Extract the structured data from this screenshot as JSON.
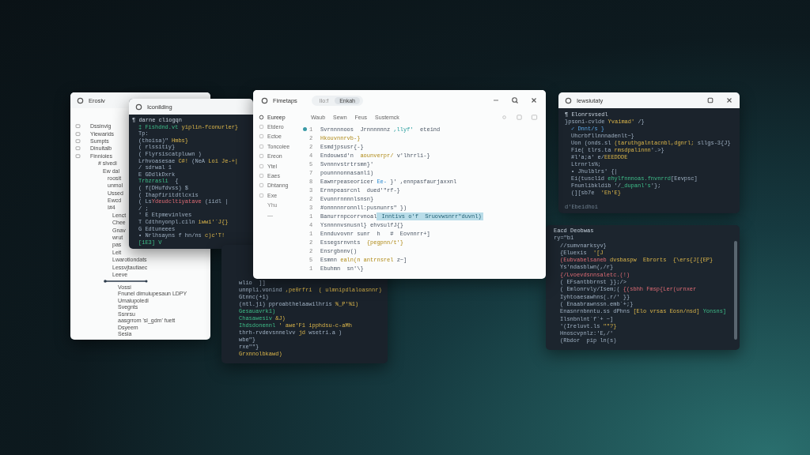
{
  "tree_window": {
    "title": "Erosiv",
    "items": [
      {
        "label": "Dssinvig"
      },
      {
        "label": "Yiewarids"
      },
      {
        "label": "Sumpts"
      },
      {
        "label": "Dinuitalb"
      },
      {
        "label": "Finnioies",
        "children": [
          {
            "label": "# slvedi",
            "children": [
              {
                "label": "Ew dal",
                "children": [
                  {
                    "label": "roosit"
                  },
                  {
                    "label": "unmol"
                  },
                  {
                    "label": "Ussed"
                  },
                  {
                    "label": "Ewcd"
                  },
                  {
                    "label": "I#4",
                    "children": [
                      {
                        "label": "Lenct"
                      },
                      {
                        "label": "Chee"
                      },
                      {
                        "label": "Gnav"
                      },
                      {
                        "label": "wrut"
                      },
                      {
                        "label": "pas"
                      },
                      {
                        "label": "Leit"
                      },
                      {
                        "label": "Lwarotiondats"
                      },
                      {
                        "label": "Lessvjtautiaec"
                      },
                      {
                        "label": "Leeve"
                      }
                    ]
                  }
                ]
              }
            ]
          }
        ]
      }
    ],
    "lower_items": [
      {
        "label": "Vossi"
      },
      {
        "label": "Fnunel dimuiupesaun LDPY"
      },
      {
        "label": "Umaiupoledi"
      },
      {
        "label": "Svegnts"
      },
      {
        "label": "Ssnrsu"
      },
      {
        "label": "aasgrrom 'sl_gdm' fuett"
      },
      {
        "label": "Dsyeem"
      },
      {
        "label": "Sesia"
      }
    ]
  },
  "code_window": {
    "title": "Iconilding",
    "header": "¶ darne cliogqn",
    "lines": [
      {
        "parts": [
          {
            "text": "‡ Fishdnd.vt",
            "kind": "name"
          },
          {
            "text": " yiplin-fconurler}",
            "kind": "string"
          }
        ]
      },
      {
        "parts": [
          {
            "text": "Tp:",
            "kind": "plain"
          }
        ]
      },
      {
        "parts": [
          {
            "text": "(thoisa)\" ",
            "kind": "plain"
          },
          {
            "text": "Hmbs}",
            "kind": "string"
          }
        ]
      },
      {
        "parts": [
          {
            "text": "( rlssitiy}",
            "kind": "plain"
          }
        ]
      },
      {
        "parts": [
          {
            "text": "( Flyrsiscatpluwn )",
            "kind": "plain"
          }
        ]
      },
      {
        "parts": [
          {
            "text": "Lrhvoasesae ",
            "kind": "plain"
          },
          {
            "text": "C#!",
            "kind": "string"
          },
          {
            "text": " (NeA",
            "kind": "plain"
          },
          {
            "text": " Loi Je-+|",
            "kind": "string"
          }
        ]
      },
      {
        "parts": [
          {
            "text": "/ sdrwal 1",
            "kind": "plain"
          }
        ]
      },
      {
        "parts": [
          {
            "text": "E GDdlkDxrk",
            "kind": "plain"
          }
        ]
      },
      {
        "parts": [
          {
            "text": "Trbzrasli",
            "kind": "name"
          },
          {
            "text": "  {",
            "kind": "plain"
          }
        ]
      },
      {
        "parts": [
          {
            "text": "( f(DHufdvss) $",
            "kind": "plain"
          }
        ]
      },
      {
        "parts": [
          {
            "text": "( Ihapfiritdtlcxis",
            "kind": "plain"
          }
        ]
      },
      {
        "parts": [
          {
            "text": "( Ls",
            "kind": "plain"
          },
          {
            "text": "Ydeudcltiyatave",
            "kind": "error"
          },
          {
            "text": " (iidl |",
            "kind": "plain"
          }
        ]
      },
      {
        "parts": [
          {
            "text": "/ ;",
            "kind": "plain"
          }
        ]
      },
      {
        "parts": [
          {
            "text": "' E Etpmevinlves",
            "kind": "plain"
          }
        ]
      },
      {
        "parts": [
          {
            "text": "T Cdthnyonpl.ciln",
            "kind": "plain"
          },
          {
            "text": " iwwi'`J{}",
            "kind": "string"
          }
        ]
      },
      {
        "parts": [
          {
            "text": "G Edtuneees",
            "kind": "plain"
          }
        ]
      },
      {
        "parts": [
          {
            "text": "• Nrlhsayns f hn/ns ",
            "kind": "plain"
          },
          {
            "text": "c)c'T!",
            "kind": "string"
          }
        ]
      },
      {
        "parts": [
          {
            "text": "[1E3] V",
            "kind": "name"
          }
        ]
      }
    ]
  },
  "back_panel": {
    "lines": [
      {
        "parts": [
          {
            "text": "wlio  ]]",
            "kind": "plain"
          }
        ]
      },
      {
        "parts": [
          {
            "text": "unnpli.vonind",
            "kind": "plain"
          },
          {
            "text": " ,pe0rfri  ( ulmnipdlaloasnnr)",
            "kind": "string"
          }
        ]
      },
      {
        "parts": [
          {
            "text": "Gtnnc(+1)",
            "kind": "plain"
          }
        ]
      },
      {
        "parts": [
          {
            "text": "(ntl.ji) pproabthelaawilhris ",
            "kind": "plain"
          },
          {
            "text": "%_P'%1)",
            "kind": "string"
          }
        ]
      },
      {
        "parts": [
          {
            "text": "Gesauavrk1)",
            "kind": "name"
          }
        ]
      },
      {
        "parts": [
          {
            "text": "Chasawesiv ",
            "kind": "name"
          },
          {
            "text": "&J)",
            "kind": "string"
          }
        ]
      },
      {
        "parts": [
          {
            "text": "Ihdsdonennl",
            "kind": "name"
          },
          {
            "text": " ' awe'F1 ipphdsu-c-aMh",
            "kind": "string"
          }
        ]
      },
      {
        "parts": [
          {
            "text": "thrh-rvdevsnnelvv ",
            "kind": "plain"
          },
          {
            "text": "jd",
            "kind": "string"
          },
          {
            "text": " wsetri.a )",
            "kind": "plain"
          }
        ]
      },
      {
        "parts": [
          {
            "text": "wbe\"}",
            "kind": "plain"
          }
        ]
      },
      {
        "parts": [
          {
            "text": "rxe\"\"}",
            "kind": "plain"
          }
        ]
      },
      {
        "parts": [
          {
            "text": "Grxnnolbkawd)",
            "kind": "string"
          }
        ]
      }
    ]
  },
  "main_window": {
    "title": "Fimetaps",
    "tabs": [
      {
        "label": "Ilo:f",
        "selected": false
      },
      {
        "label": "Enkah",
        "selected": true
      }
    ],
    "sidebar": {
      "header": "Eureep",
      "items": [
        "Etdero",
        "Ectoe",
        "Toncoiee",
        "Ereon",
        "Ytel",
        "Eaes",
        "Dhtanng",
        "Exe",
        "Yhu",
        "—"
      ]
    },
    "toolbar": [
      "Waub",
      "Sewn",
      "Feus",
      "Sustemck"
    ],
    "lines": [
      {
        "n": "1",
        "breakpoint": true,
        "parts": [
          {
            "text": "Svrnnnnoos  Jrnnnnnnz ",
            "kind": "plain"
          },
          {
            "text": ",llyf'",
            "kind": "attr"
          },
          {
            "text": "  eteind",
            "kind": "plain"
          }
        ]
      },
      {
        "n": "2",
        "breakpoint": false,
        "parts": [
          {
            "text": "Hkouvnnrvb-}",
            "kind": "string"
          }
        ]
      },
      {
        "n": "2",
        "breakpoint": false,
        "parts": [
          {
            "text": "Esmdjpsusr{-}",
            "kind": "plain"
          }
        ]
      },
      {
        "n": "4",
        "breakpoint": false,
        "parts": [
          {
            "text": "Endouwsd'n  ",
            "kind": "plain"
          },
          {
            "text": "aounverpr/",
            "kind": "string"
          },
          {
            "text": " v'lhrrli-}",
            "kind": "plain"
          }
        ]
      },
      {
        "n": "5",
        "breakpoint": false,
        "parts": [
          {
            "text": "Svnnnvstrtrsmn}'",
            "kind": "plain"
          }
        ]
      },
      {
        "n": "7",
        "breakpoint": false,
        "parts": [
          {
            "text": "pounnnonnasanl1)",
            "kind": "plain"
          }
        ]
      },
      {
        "n": "8",
        "breakpoint": false,
        "parts": [
          {
            "text": "Eawnrpeaseoricer ",
            "kind": "plain"
          },
          {
            "text": "Ee-",
            "kind": "type"
          },
          {
            "text": " }' ,ennpasfaurjaxxnl",
            "kind": "plain"
          }
        ]
      },
      {
        "n": "3",
        "breakpoint": false,
        "parts": [
          {
            "text": "Ernnpeasrcnl  dued'\"rf-}",
            "kind": "plain"
          }
        ]
      },
      {
        "n": "2",
        "breakpoint": false,
        "parts": [
          {
            "text": "Evunnrnnnnlsnsn}",
            "kind": "plain"
          }
        ]
      },
      {
        "n": "3",
        "breakpoint": false,
        "parts": [
          {
            "text": "#onnnnnronnll:pusnunrs\" })",
            "kind": "plain"
          }
        ]
      },
      {
        "n": "1",
        "breakpoint": false,
        "parts": [
          {
            "text": "Banurrnpcorrvnoal",
            "kind": "plain"
          },
          {
            "text": " Inntivs o'f  Sruovwsnrr\"duvnl)",
            "kind": "selection"
          }
        ]
      },
      {
        "n": "4",
        "breakpoint": false,
        "parts": [
          {
            "text": "Ysnnnnvsnusnl} ehvsulfJ{}",
            "kind": "plain"
          }
        ]
      },
      {
        "n": "1",
        "breakpoint": false,
        "parts": [
          {
            "text": "Ennduvovnr sunr  h   #  Eovnnrr+]",
            "kind": "plain"
          }
        ]
      },
      {
        "n": "2",
        "breakpoint": false,
        "parts": [
          {
            "text": "Essegsrnvnts  ",
            "kind": "plain"
          },
          {
            "text": "{pegpnn/t'}",
            "kind": "string"
          }
        ]
      },
      {
        "n": "2",
        "breakpoint": false,
        "parts": [
          {
            "text": "Ensrgbnnv()",
            "kind": "plain"
          }
        ]
      },
      {
        "n": "5",
        "breakpoint": false,
        "parts": [
          {
            "text": "Esmnn ",
            "kind": "plain"
          },
          {
            "text": "ealn(n antrnsrel",
            "kind": "string"
          },
          {
            "text": " z~]",
            "kind": "plain"
          }
        ]
      },
      {
        "n": "1",
        "breakpoint": false,
        "parts": [
          {
            "text": "Ebuhmn  sn'\\}",
            "kind": "plain"
          }
        ]
      }
    ]
  },
  "right_window": {
    "title": "Iewsiutaty",
    "header": "¶ Elonrsvsedl",
    "footer": "d'Ebeidhoi",
    "lines": [
      {
        "parts": [
          {
            "text": "}psoni-cvlde ",
            "kind": "plain"
          },
          {
            "text": "Yvaimad'",
            "kind": "string"
          },
          {
            "text": " /}",
            "kind": "plain"
          }
        ]
      },
      {
        "parts": [
          {
            "text": "✓ Dnnt/s }",
            "kind": "type"
          }
        ]
      },
      {
        "parts": [
          {
            "text": "Uhcrbfllnnnadenlt~}",
            "kind": "plain"
          }
        ]
      },
      {
        "parts": [
          {
            "text": "Uon (onds.sl ",
            "kind": "plain"
          },
          {
            "text": "(taruthgalntacnbl,dgnrl;",
            "kind": "string"
          },
          {
            "text": " sllgs-3{J}",
            "kind": "plain"
          }
        ]
      },
      {
        "parts": [
          {
            "text": "Fie( tlrs.ta ",
            "kind": "plain"
          },
          {
            "text": "rmsdpalinnn",
            "kind": "string"
          },
          {
            "text": "'.>}",
            "kind": "plain"
          }
        ]
      },
      {
        "parts": [
          {
            "text": "#l'a;a' e/",
            "kind": "plain"
          },
          {
            "text": "EEEDDDE",
            "kind": "string"
          }
        ]
      },
      {
        "parts": [
          {
            "text": "Ltrnrls%;",
            "kind": "plain"
          }
        ]
      },
      {
        "parts": [
          {
            "text": "• Jhulblrs' {|",
            "kind": "plain"
          }
        ]
      },
      {
        "parts": [
          {
            "text": "Ei(tuscl1d ",
            "kind": "plain"
          },
          {
            "text": "ehylfnnnoas.fnvnrrd",
            "kind": "name"
          },
          {
            "text": "[Eevpsc]",
            "kind": "plain"
          }
        ]
      },
      {
        "parts": [
          {
            "text": "Fnunlibkldib '/",
            "kind": "plain"
          },
          {
            "text": "_dupanl's",
            "kind": "name"
          },
          {
            "text": "'};",
            "kind": "plain"
          }
        ]
      },
      {
        "parts": [
          {
            "text": "(][sb7e  ",
            "kind": "plain"
          },
          {
            "text": "'Eh'E}",
            "kind": "string"
          }
        ]
      }
    ]
  },
  "dark_panel": {
    "header": "Eacd Deobwas",
    "lines": [
      {
        "parts": [
          {
            "text": "ry=\"b1",
            "kind": "plain"
          }
        ]
      },
      {
        "parts": [
          {
            "text": "//sumvnarksyv}",
            "kind": "plain"
          }
        ]
      },
      {
        "parts": [
          {
            "text": "{Eluexis  ",
            "kind": "plain"
          },
          {
            "text": "'[J",
            "kind": "string"
          }
        ]
      },
      {
        "parts": [
          {
            "text": "(Eubvabelsaneb ",
            "kind": "error"
          },
          {
            "text": "dvsbaspw  Ebrorts  {\\ers{J[{EP}",
            "kind": "string"
          }
        ]
      },
      {
        "parts": [
          {
            "text": "Ys'ndasblwn(,/r}",
            "kind": "plain"
          }
        ]
      },
      {
        "parts": [
          {
            "text": "{/Lvoevdsnnsaletc.(!)",
            "kind": "error"
          }
        ]
      },
      {
        "parts": [
          {
            "text": "( EFsantbbrnst }};/>",
            "kind": "plain"
          }
        ]
      },
      {
        "parts": [
          {
            "text": "( Emlonrvly/Isem;( ",
            "kind": "plain"
          },
          {
            "text": "{(sbhh Fmsp{Ler(urnxer",
            "kind": "error"
          }
        ]
      },
      {
        "parts": [
          {
            "text": "Iyhtoaesawhns(.r/' }}",
            "kind": "plain"
          }
        ]
      },
      {
        "parts": [
          {
            "text": "( Enaabrawnssn.emb`+;}",
            "kind": "plain"
          }
        ]
      },
      {
        "parts": [
          {
            "text": "Enasnrnbnntu.ss dPhns ",
            "kind": "plain"
          },
          {
            "text": "[Elo vrsas Eosn/nsd]",
            "kind": "string"
          },
          {
            "text": " Yonsns]",
            "kind": "name"
          }
        ]
      },
      {
        "parts": [
          {
            "text": "Ilsnbnlnt`f`+ ~]",
            "kind": "plain"
          }
        ]
      },
      {
        "parts": [
          {
            "text": "'(Ireluvt.ls",
            "kind": "plain"
          },
          {
            "text": " \"\"?}",
            "kind": "string"
          }
        ]
      },
      {
        "parts": [
          {
            "text": "Hnoscvpnlz:'E,/'",
            "kind": "plain"
          }
        ]
      },
      {
        "parts": [
          {
            "text": "(Rbdor  pip ln(s)",
            "kind": "plain"
          }
        ]
      }
    ]
  }
}
